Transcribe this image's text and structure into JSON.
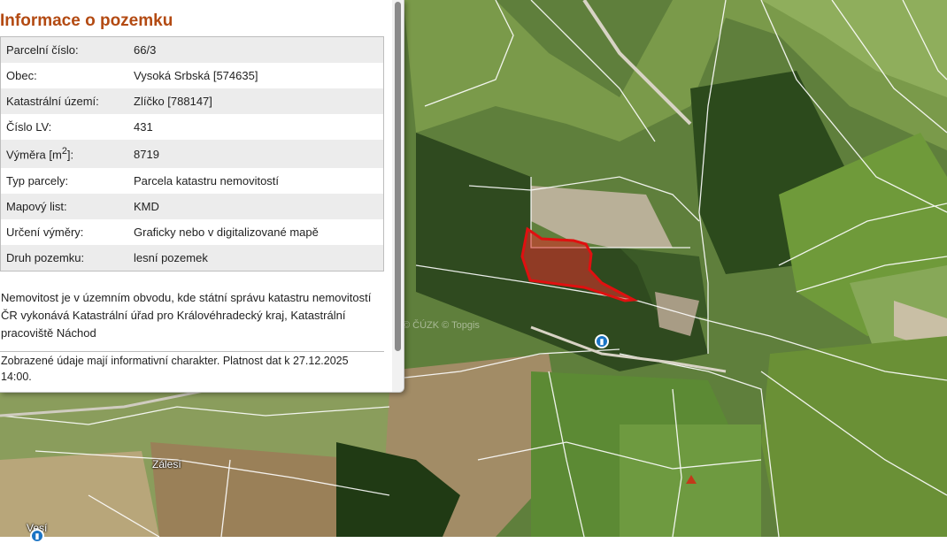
{
  "panel": {
    "title": "Informace o pozemku",
    "rows": [
      {
        "label": "Parcelní číslo:",
        "value": "66/3"
      },
      {
        "label": "Obec:",
        "value": "Vysoká Srbská [574635]"
      },
      {
        "label": "Katastrální území:",
        "value": "Zlíčko [788147]"
      },
      {
        "label": "Číslo LV:",
        "value": "431"
      },
      {
        "label_prefix": "Výměra [m",
        "label_sup": "2",
        "label_suffix": "]:",
        "value": "8719"
      },
      {
        "label": "Typ parcely:",
        "value": "Parcela katastru nemovitostí"
      },
      {
        "label": "Mapový list:",
        "value": "KMD"
      },
      {
        "label": "Určení výměry:",
        "value": "Graficky nebo v digitalizované mapě"
      },
      {
        "label": "Druh pozemku:",
        "value": "lesní pozemek"
      }
    ],
    "note": "Nemovitost je v územním obvodu, kde státní správu katastru nemovitostí ČR vykonává Katastrální úřad pro Královéhradecký kraj, Katastrální pracoviště Náchod",
    "validity": "Zobrazené údaje mají informativní charakter. Platnost dat k 27.12.2025 14:00."
  },
  "map": {
    "place_label_1": "Zálesí",
    "place_label_2": "Vesí",
    "watermark": "© ČÚZK © Topgis",
    "bus_icon": "bus-stop-icon",
    "colors": {
      "accent_title": "#b34a12",
      "parcel_stroke": "#e01010",
      "parcel_fill": "#e0302a",
      "bus_stop": "#1b74c4"
    }
  }
}
